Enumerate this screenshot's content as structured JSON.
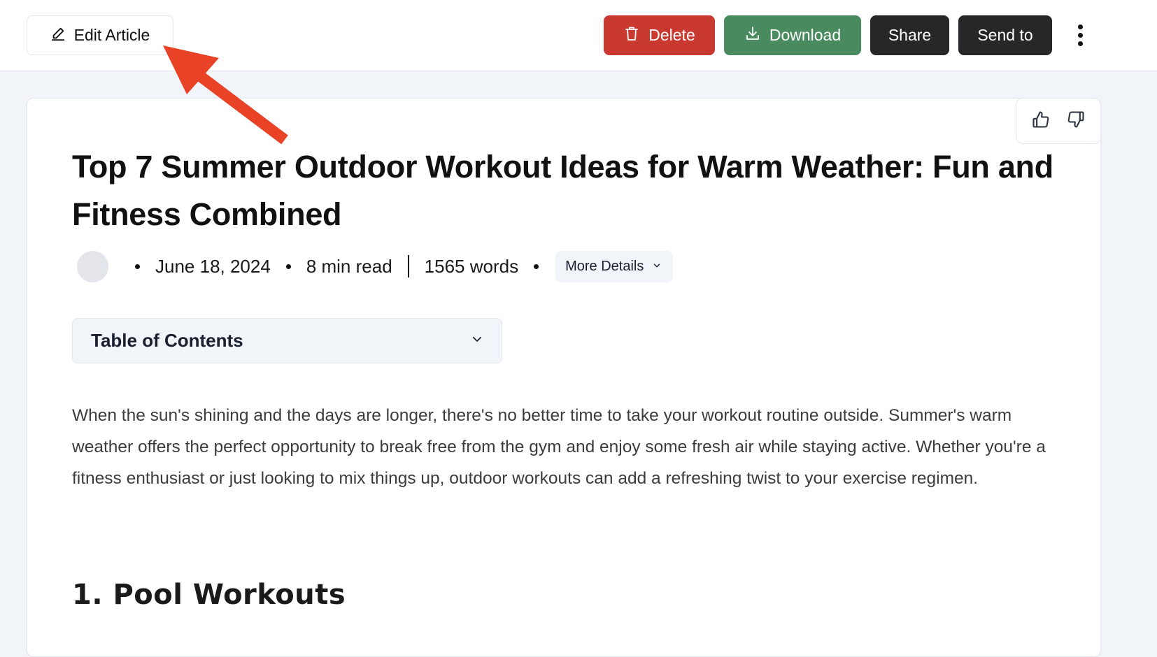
{
  "toolbar": {
    "edit_label": "Edit Article",
    "delete_label": "Delete",
    "download_label": "Download",
    "share_label": "Share",
    "send_to_label": "Send to",
    "more_icon": "kebab-vertical-icon"
  },
  "colors": {
    "delete": "#c9392f",
    "download": "#4a8a5f",
    "dark_button": "#27272a",
    "page_background": "#f1f4f9",
    "annotation_arrow": "#e84327"
  },
  "feedback": {
    "like_icon": "thumbs-up-icon",
    "dislike_icon": "thumbs-down-icon"
  },
  "article": {
    "title": "Top 7 Summer Outdoor Workout Ideas for Warm Weather: Fun and Fitness Combined",
    "date": "June 18, 2024",
    "read_time": "8 min read",
    "word_count": "1565 words",
    "more_details_label": "More Details",
    "toc_label": "Table of Contents",
    "intro": "When the sun's shining and the days are longer, there's no better time to take your workout routine outside. Summer's warm weather offers the perfect opportunity to break free from the gym and enjoy some fresh air while staying active. Whether you're a fitness enthusiast or just looking to mix things up, outdoor workouts can add a refreshing twist to your exercise regimen.",
    "section_1_heading": "1. Pool Workouts"
  },
  "annotation": {
    "type": "arrow",
    "points_to": "edit-article-button"
  }
}
